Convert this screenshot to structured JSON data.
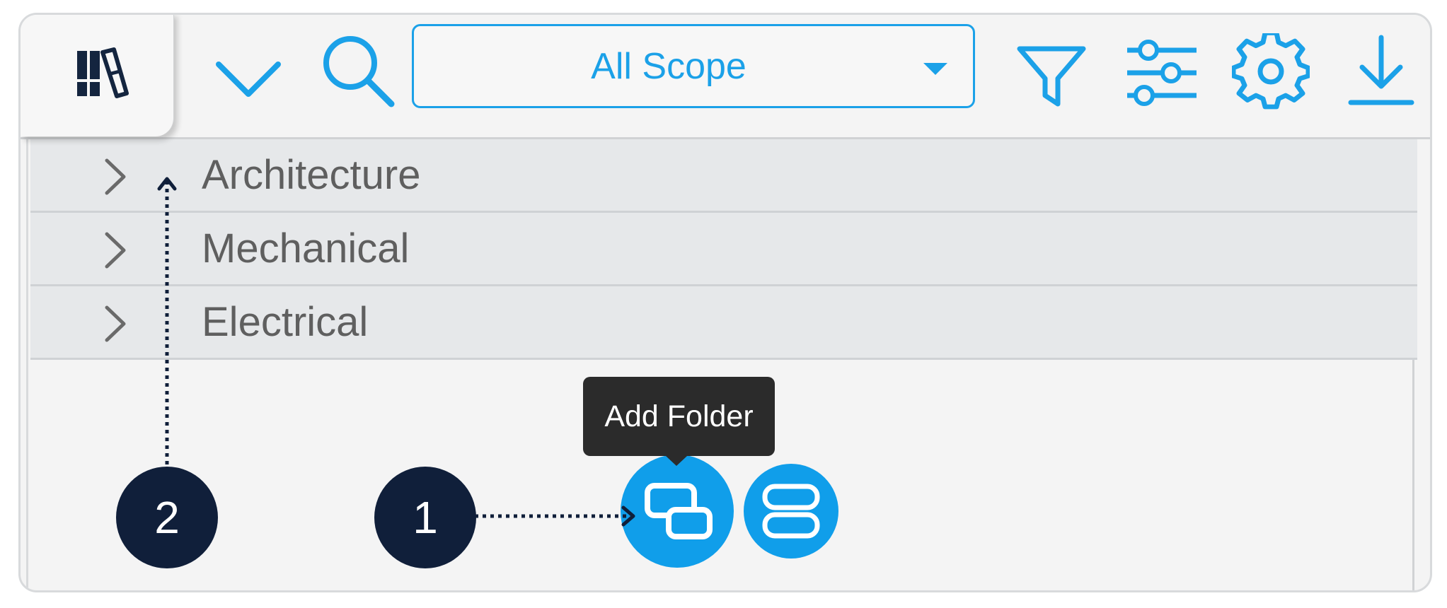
{
  "toolbar": {
    "library_icon": "library-books-icon",
    "collapse_icon": "chevron-down-icon",
    "search_icon": "search-icon",
    "scope_select": {
      "selected": "All Scope",
      "caret_icon": "caret-down-icon"
    },
    "filter_icon": "filter-icon",
    "adjust_icon": "sliders-icon",
    "settings_icon": "gear-icon",
    "download_icon": "download-icon"
  },
  "tree": {
    "items": [
      {
        "label": "Architecture",
        "icon": "chevron-right-icon"
      },
      {
        "label": "Mechanical",
        "icon": "chevron-right-icon"
      },
      {
        "label": "Electrical",
        "icon": "chevron-right-icon"
      }
    ]
  },
  "actions": {
    "add_folder_tooltip": "Add Folder",
    "add_folder_icon": "add-folder-icon",
    "add_group_icon": "stacked-rows-icon"
  },
  "callouts": {
    "one": "1",
    "two": "2"
  },
  "colors": {
    "accent": "#1ba1e8",
    "fab": "#109eea",
    "callout": "#101f3a",
    "tooltip_bg": "#2b2b2b",
    "row_bg": "#e6e8ea",
    "row_text": "#5f5f5f",
    "panel_bg": "#f4f4f4"
  }
}
